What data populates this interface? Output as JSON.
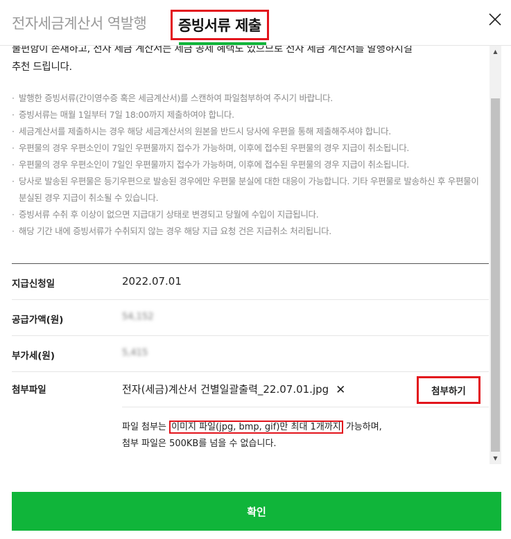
{
  "header": {
    "tab_reverse": "전자세금계산서 역발행",
    "tab_submit": "증빙서류 제출"
  },
  "intro": {
    "line1": "불편함이 존재하고, 전자 세금 계산서는 세금 공제 혜택도 있으므로 전자 세금 계산서를 발행하시길",
    "line2": "추천 드립니다."
  },
  "notes": [
    "발행한 증빙서류(간이영수증 혹은 세금계산서)를 스캔하여 파일첨부하여 주시기 바랍니다.",
    "증빙서류는 매월 1일부터 7일 18:00까지 제출하여야 합니다.",
    "세금계산서를 제출하시는 경우 해당 세금계산서의 원본을 반드시 당사에 우편을 통해 제출해주셔야 합니다.",
    "우편물의 경우 우편소인이 7일인 우편물까지 접수가 가능하며, 이후에 접수된 우편물의 경우 지급이 취소됩니다.",
    "우편물의 경우 우편소인이 7일인 우편물까지 접수가 가능하며, 이후에 접수된 우편물의 경우 지급이 취소됩니다.",
    "당사로 발송된 우편물은 등기우편으로 발송된 경우에만 우편물 분실에 대한 대응이 가능합니다. 기타 우편물로 발송하신 후 우편물이 분실된 경우 지급이 취소될 수 있습니다.",
    "증빙서류 수취 후 이상이 없으면 지급대기 상태로 변경되고 당월에 수입이 지급됩니다.",
    "해당 기간 내에 증빙서류가 수취되지 않는 경우 해당 지급 요청 건은 지급취소 처리됩니다."
  ],
  "form": {
    "date_label": "지급신청일",
    "date_value": "2022.07.01",
    "supply_label": "공급가액(원)",
    "supply_value": "54,152",
    "vat_label": "부가세(원)",
    "vat_value": "5,415",
    "attach_label": "첨부파일",
    "file_name": "전자(세금)계산서 건별일괄출력_22.07.01.jpg",
    "remove_symbol": "✕",
    "attach_button": "첨부하기",
    "help_pre": "파일 첨부는 ",
    "help_highlight": "이미지 파일(jpg, bmp, gif)만 최대 1개까지",
    "help_post": " 가능하며,",
    "help_line2": "첨부 파일은 500KB를 넘을 수 없습니다."
  },
  "footer": {
    "confirm": "확인"
  },
  "colors": {
    "accent_green": "#10b53a",
    "highlight_red": "#e2141c"
  },
  "icons": {
    "close": "close-icon",
    "scroll_up": "scroll-up-arrow-icon",
    "scroll_down": "scroll-down-arrow-icon",
    "remove_file": "remove-file-icon"
  }
}
